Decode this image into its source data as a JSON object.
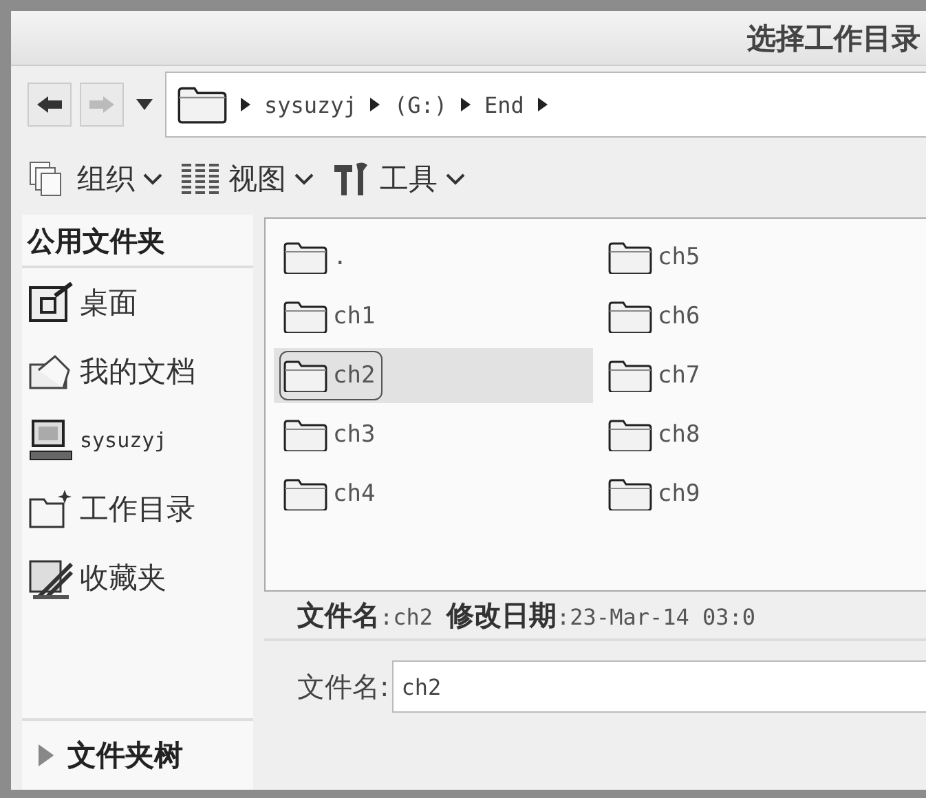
{
  "window": {
    "title": "选择工作目录"
  },
  "navigation": {
    "back": {
      "disabled": false
    },
    "forward": {
      "disabled": true
    }
  },
  "address_bar": {
    "crumbs": [
      "sysuzyj",
      "(G:)",
      "End"
    ]
  },
  "toolbar": [
    {
      "kind": "organize",
      "label": "组织"
    },
    {
      "kind": "view",
      "label": "视图"
    },
    {
      "kind": "tools",
      "label": "工具"
    }
  ],
  "sidebar": {
    "header": "公用文件夹",
    "items": [
      {
        "kind": "desktop",
        "label": "桌面"
      },
      {
        "kind": "documents",
        "label": "我的文档"
      },
      {
        "kind": "computer",
        "label": "sysuzyj"
      },
      {
        "kind": "workdir",
        "label": "工作目录"
      },
      {
        "kind": "favorites",
        "label": "收藏夹"
      }
    ],
    "footer": "文件夹树"
  },
  "files": [
    {
      "name": ".",
      "selected": false
    },
    {
      "name": "ch1",
      "selected": false
    },
    {
      "name": "ch2",
      "selected": true
    },
    {
      "name": "ch3",
      "selected": false
    },
    {
      "name": "ch4",
      "selected": false
    },
    {
      "name": "ch5",
      "selected": false
    },
    {
      "name": "ch6",
      "selected": false
    },
    {
      "name": "ch7",
      "selected": false
    },
    {
      "name": "ch8",
      "selected": false
    },
    {
      "name": "ch9",
      "selected": false
    }
  ],
  "details": [
    {
      "label": "文件名",
      "value": ":ch2"
    },
    {
      "label": "修改日期",
      "value": ":23-Mar-14 03:0"
    }
  ],
  "filename_field": {
    "label": "文件名:",
    "value": "ch2"
  }
}
